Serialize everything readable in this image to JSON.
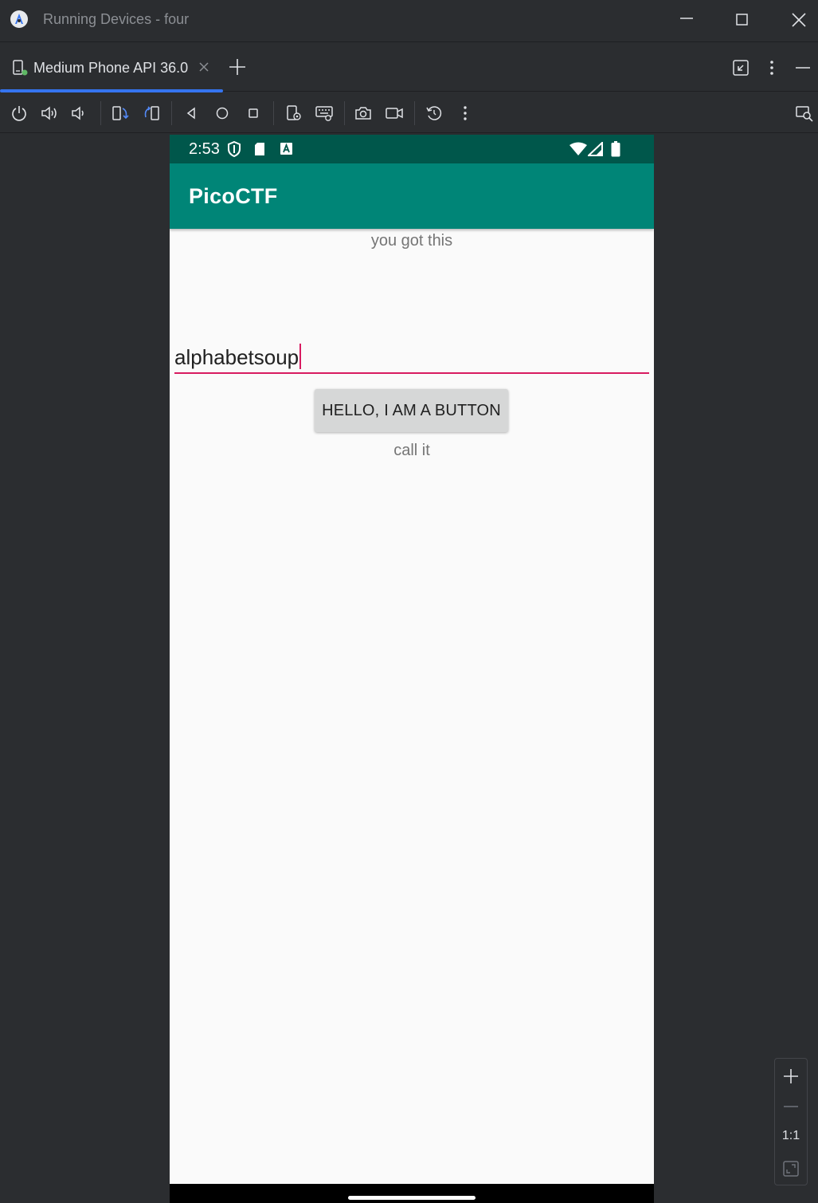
{
  "window": {
    "title": "Running Devices - four",
    "controls": [
      "minimize-icon",
      "maximize-icon",
      "close-icon"
    ]
  },
  "tabs": [
    {
      "label": "Medium Phone API 36.0",
      "active": true,
      "icon": "device-icon"
    }
  ],
  "tabrow_actions": [
    "restore-icon",
    "more-vert-icon",
    "minimize-panel-icon"
  ],
  "toolbar": {
    "buttons": [
      "power-icon",
      "volume-up-icon",
      "volume-down-icon",
      "rotate-left-icon",
      "rotate-right-icon",
      "back-icon",
      "home-icon",
      "overview-icon",
      "device-settings-icon",
      "keyboard-icon",
      "screenshot-icon",
      "screen-record-icon",
      "snapshot-icon",
      "more-vert-icon",
      "device-mirror-icon"
    ]
  },
  "device": {
    "status_bar": {
      "time": "2:53",
      "icons": [
        "shield-icon",
        "sd-card-icon",
        "a-icon",
        "wifi-icon",
        "signal-icon",
        "battery-icon"
      ]
    },
    "app_bar": {
      "title": "PicoCTF"
    },
    "hint_top": "you got this",
    "input": {
      "value": "alphabetsoup"
    },
    "button": {
      "label": "HELLO, I AM A BUTTON"
    },
    "hint_bottom": "call it"
  },
  "zoom": {
    "zoom_in": "+",
    "zoom_out": "—",
    "reset_label": "1:1",
    "fit": "fit-screen-icon"
  },
  "colors": {
    "accent": "#3574f0",
    "status_bar": "#00574b",
    "app_bar": "#008577",
    "input_underline": "#d81b60",
    "ide_background": "#2b2d30",
    "device_background": "#fafafa"
  }
}
